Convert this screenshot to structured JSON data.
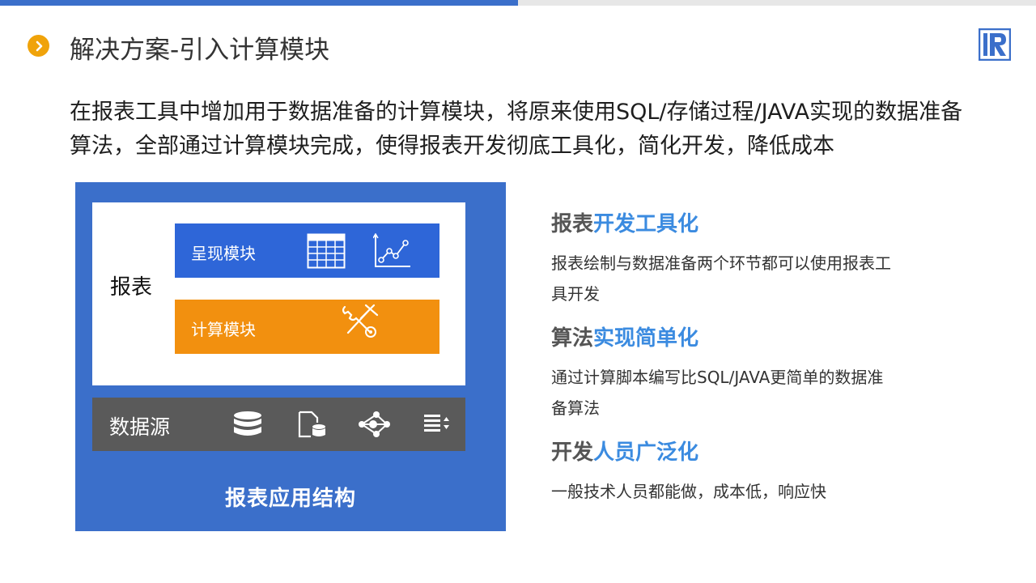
{
  "header": {
    "title": "解决方案-引入计算模块",
    "title_icon": "chevron-right-icon",
    "logo": "raqsoft-r-logo",
    "accent_color": "#3b6fca",
    "title_icon_color": "#f0a30a"
  },
  "intro": {
    "line1": "在报表工具中增加用于数据准备的计算模块，将原来使用SQL/存储过程/JAVA实现的数据准备",
    "line2": "算法，全部通过计算模块完成，使得报表开发彻底工具化，简化开发，降低成本"
  },
  "diagram": {
    "report_label": "报表",
    "present_module": "呈现模块",
    "compute_module": "计算模块",
    "present_icons": [
      "table-grid-icon",
      "line-chart-icon"
    ],
    "compute_icon": "tools-icon",
    "datasource_label": "数据源",
    "datasource_icons": [
      "database-icon",
      "file-database-icon",
      "network-share-icon",
      "sort-list-icon"
    ],
    "caption": "报表应用结构",
    "colors": {
      "frame": "#3b6fca",
      "present": "#2e66d8",
      "compute": "#f2900f",
      "datasource": "#5a5a5a"
    }
  },
  "features": [
    {
      "title_prefix": "报表",
      "title_highlight": "开发工具化",
      "desc_lines": [
        "报表绘制与数据准备两个环节都可以使用报表工",
        "具开发"
      ]
    },
    {
      "title_prefix": "算法",
      "title_highlight": "实现简单化",
      "desc_lines": [
        "通过计算脚本编写比SQL/JAVA更简单的数据准",
        "备算法"
      ]
    },
    {
      "title_prefix": "开发",
      "title_highlight": "人员广泛化",
      "desc_lines": [
        "一般技术人员都能做，成本低，响应快"
      ]
    }
  ]
}
